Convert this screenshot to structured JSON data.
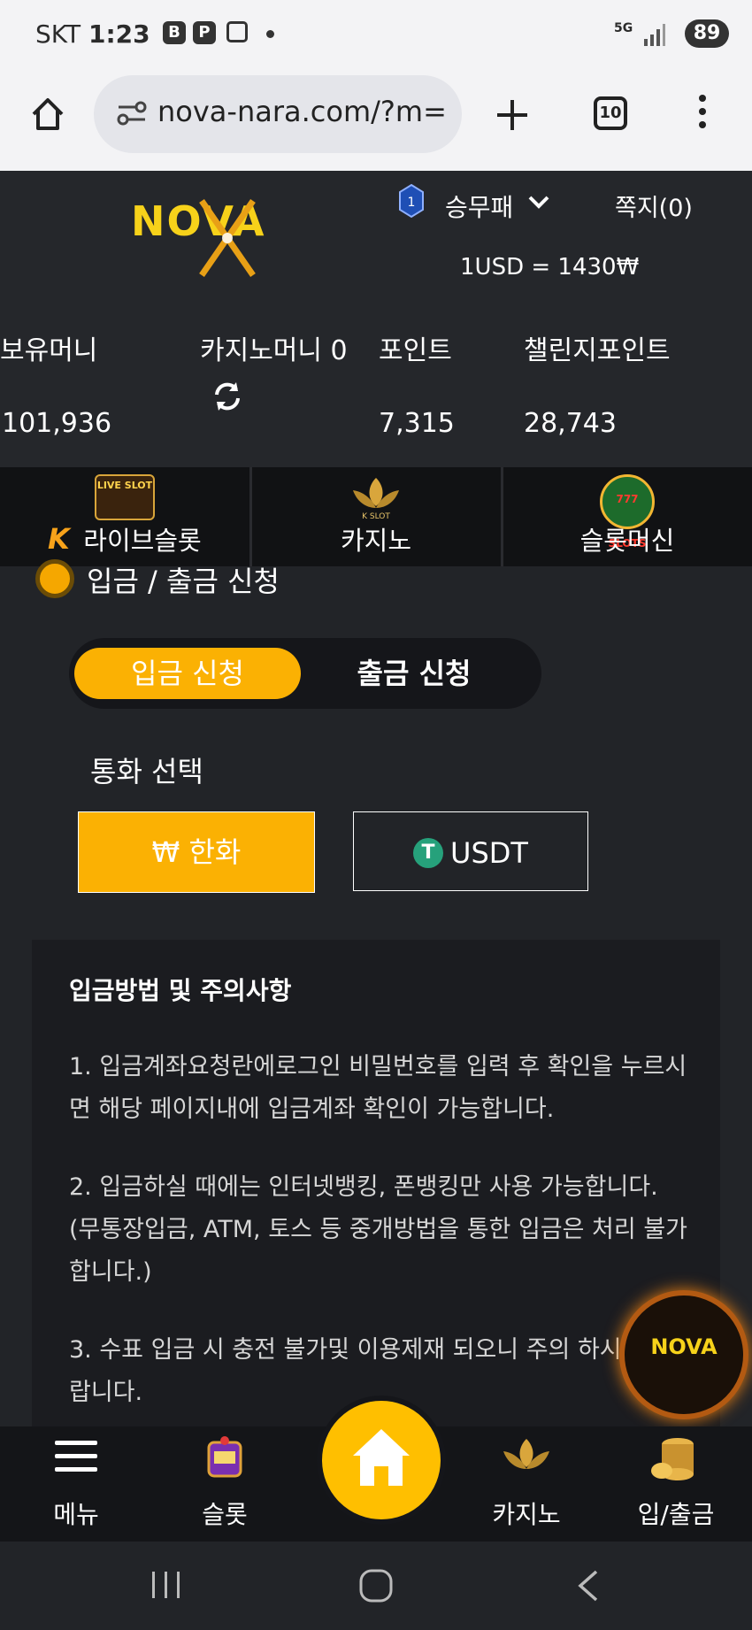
{
  "status_bar": {
    "carrier": "SKT",
    "time": "1:23",
    "network": "5G",
    "battery": "89"
  },
  "browser": {
    "url": "nova-nara.com/?m=",
    "tab_count": "10"
  },
  "header": {
    "logo_text": "NOVA",
    "user_name": "승무패",
    "level": "1",
    "messages": "쪽지(0)",
    "exchange_rate": "1USD = 1430₩"
  },
  "balances": {
    "money_label": "보유머니",
    "money_value": "101,936",
    "casino_label": "카지노머니 0",
    "point_label": "포인트",
    "point_value": "7,315",
    "challenge_label": "챌린지포인트",
    "challenge_value": "28,743"
  },
  "game_tabs": [
    {
      "label": "라이브슬롯",
      "icon_text": "LIVE SLOT"
    },
    {
      "label": "카지노",
      "icon_text": "K SLOT"
    },
    {
      "label": "슬롯머신",
      "icon_text": "777 SLOTS"
    }
  ],
  "section_title": "입금 / 출금 신청",
  "segments": {
    "deposit": "입금 신청",
    "withdraw": "출금 신청"
  },
  "currency": {
    "label": "통화 선택",
    "krw": "₩ 한화",
    "usdt": "USDT"
  },
  "notice": {
    "title": "입금방법 및 주의사항",
    "items": [
      "1. 입금계좌요청란에로그인 비밀번호를 입력 후 확인을 누르시면 해당 페이지내에 입금계좌 확인이 가능합니다.",
      "2. 입금하실 때에는 인터넷뱅킹, 폰뱅킹만 사용 가능합니다.(무통장입금, ATM, 토스 등 중개방법을 통한 입금은 처리 불가합니다.)",
      "3. 수표 입금 시 충전 불가및 이용제재 되오니 주의 하시기 바랍니다."
    ]
  },
  "bottom_nav": {
    "menu": "메뉴",
    "slot": "슬롯",
    "casino": "카지노",
    "deposit": "입/출금"
  },
  "colors": {
    "accent": "#fbb103",
    "background": "#222428",
    "tether": "#26a17b"
  }
}
